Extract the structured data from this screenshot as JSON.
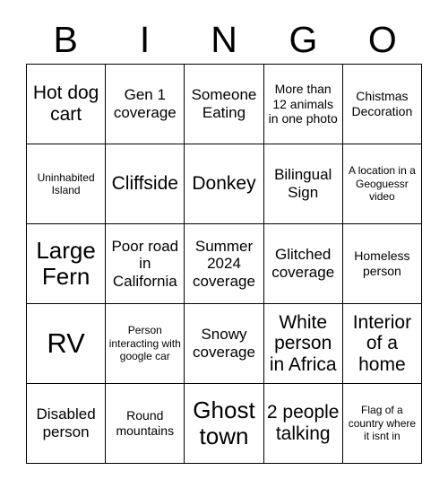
{
  "card": {
    "title": "BINGO",
    "header_letters": [
      "B",
      "I",
      "N",
      "G",
      "O"
    ],
    "grid_size": "5x5",
    "background_color": "#ffffff",
    "text_color": "#000000",
    "border_color": "#000000",
    "rows": [
      [
        {
          "text": "Hot dog cart",
          "size": "lg"
        },
        {
          "text": "Gen 1 coverage",
          "size": "md"
        },
        {
          "text": "Someone Eating",
          "size": "md"
        },
        {
          "text": "More than 12 animals in one photo",
          "size": "sm"
        },
        {
          "text": "Chistmas Decoration",
          "size": "sm"
        }
      ],
      [
        {
          "text": "Uninhabited Island",
          "size": "xs"
        },
        {
          "text": "Cliffside",
          "size": "lg"
        },
        {
          "text": "Donkey",
          "size": "lg"
        },
        {
          "text": "Bilingual Sign",
          "size": "md"
        },
        {
          "text": "A location in a Geoguessr video",
          "size": "xs"
        }
      ],
      [
        {
          "text": "Large Fern",
          "size": "xl"
        },
        {
          "text": "Poor road in California",
          "size": "md"
        },
        {
          "text": "Summer 2024 coverage",
          "size": "md"
        },
        {
          "text": "Glitched coverage",
          "size": "md"
        },
        {
          "text": "Homeless person",
          "size": "sm"
        }
      ],
      [
        {
          "text": "RV",
          "size": "xxl"
        },
        {
          "text": "Person interacting with google car",
          "size": "xs"
        },
        {
          "text": "Snowy coverage",
          "size": "md"
        },
        {
          "text": "White person in Africa",
          "size": "lg"
        },
        {
          "text": "Interior of a home",
          "size": "lg"
        }
      ],
      [
        {
          "text": "Disabled person",
          "size": "md"
        },
        {
          "text": "Round mountains",
          "size": "sm"
        },
        {
          "text": "Ghost town",
          "size": "xl"
        },
        {
          "text": "2 people talking",
          "size": "lg"
        },
        {
          "text": "Flag of a country where it isnt in",
          "size": "xs"
        }
      ]
    ]
  }
}
